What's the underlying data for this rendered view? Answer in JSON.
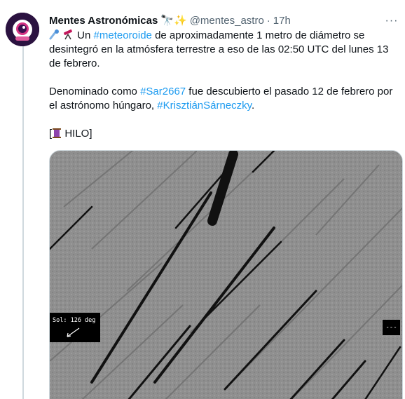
{
  "tweet": {
    "author_name": "Mentes Astronómicas",
    "author_emoji": "🔭✨",
    "handle": "@mentes_astro",
    "separator": "·",
    "time": "17h",
    "more_label": "···",
    "line1_prefix": " Un ",
    "hashtag1": "#meteoroide",
    "line1_rest": " de aproximadamente 1 metro de diámetro se desintegró en la atmósfera terrestre a eso de las 02:50 UTC del lunes 13 de febrero.",
    "line2_prefix": "Denominado como ",
    "hashtag2": "#Sar2667",
    "line2_mid": " fue descubierto el pasado 12 de febrero por el astrónomo húngaro, ",
    "hashtag3": "#KrisztiánSárneczky",
    "line2_end": ".",
    "thread_open": "[",
    "thread_label": " HILO]"
  },
  "media": {
    "overlay_text": "Sol: 126 deg",
    "corner_text": "---"
  }
}
